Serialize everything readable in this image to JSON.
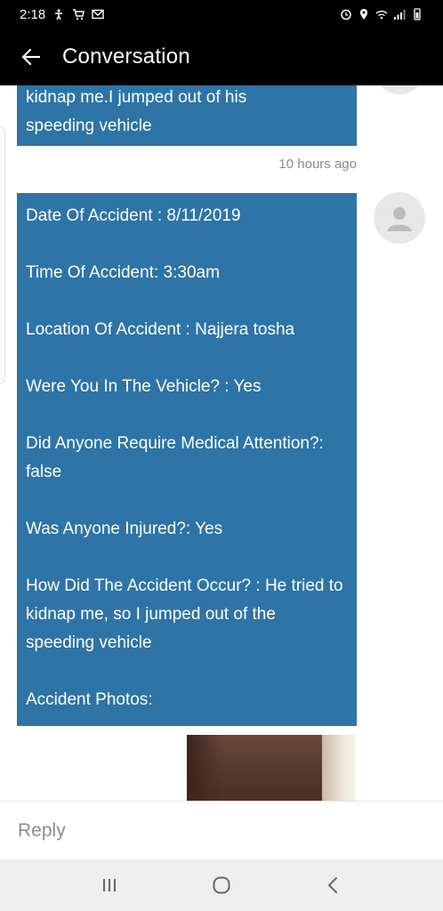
{
  "status_bar": {
    "time": "2:18",
    "left_icons": [
      "accessibility-icon",
      "shopping-cart-icon",
      "gmail-icon"
    ],
    "right_icons": [
      "alarm-icon",
      "location-icon",
      "wifi-icon",
      "signal-icon",
      "battery-icon"
    ]
  },
  "app_bar": {
    "title": "Conversation",
    "back_icon": "back-arrow-icon"
  },
  "messages": {
    "previous": {
      "line1": "kidnap me.I jumped out of his",
      "line2": "speeding vehicle"
    },
    "timestamp": "10 hours ago",
    "report": {
      "date_label": "Date Of Accident",
      "date_sep": " : ",
      "date_value": "8/11/2019",
      "time_label": "Time Of Accident",
      "time_sep": ": ",
      "time_value": "3:30am",
      "location_label": "Location Of Accident",
      "location_sep": " : ",
      "location_value": "Najjera tosha",
      "in_vehicle_label": "Were You In The Vehicle?",
      "in_vehicle_sep": " : ",
      "in_vehicle_value": "Yes",
      "medical_label": "Did Anyone Require Medical Attention?",
      "medical_sep": ": ",
      "medical_value": "false",
      "injured_label": "Was Anyone Injured?",
      "injured_sep": ": ",
      "injured_value": "Yes",
      "how_label": "How Did The Accident Occur?",
      "how_sep": " : ",
      "how_value": "He tried to kidnap me, so I jumped out of the speeding vehicle",
      "photos_label": "Accident Photos",
      "photos_sep": ":"
    }
  },
  "reply": {
    "placeholder": "Reply"
  },
  "nav": {
    "recents_icon": "recents-icon",
    "home_icon": "home-icon",
    "back_icon": "back-icon"
  },
  "colors": {
    "bubble": "#2e74a6",
    "app_bar": "#000000",
    "timestamp": "#8a8a8a"
  }
}
